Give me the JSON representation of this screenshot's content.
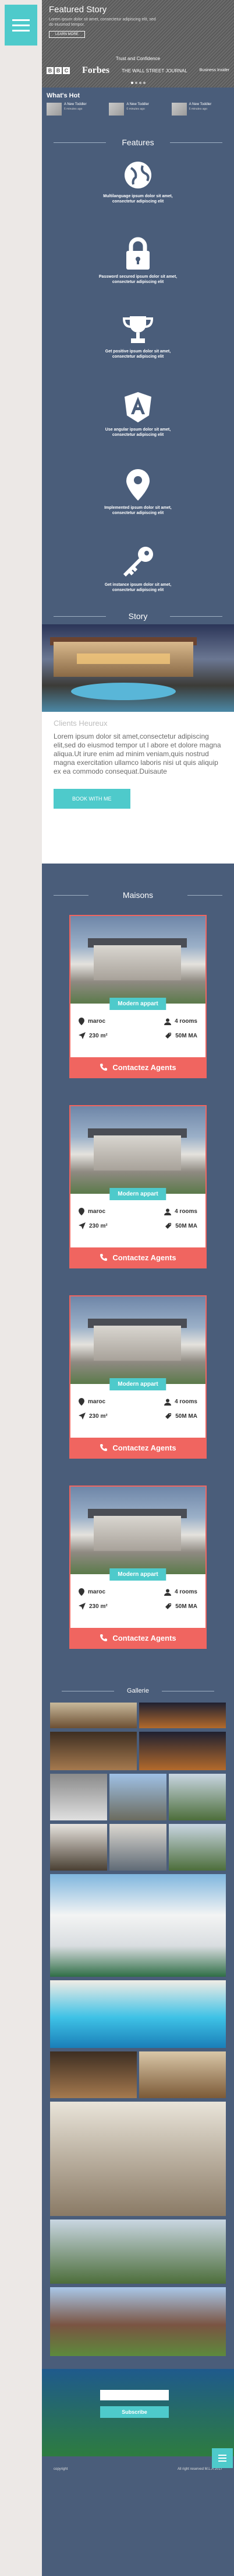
{
  "featured": {
    "title": "Featured Story",
    "text": "Lorem ipsum dolor sit amet, consectetur adipiscing elit, sed do eiusmod tempor.",
    "learn_label": "LEARN MORE",
    "trust_text": "Trust and Confidence"
  },
  "logos": {
    "bbc": [
      "B",
      "B",
      "C"
    ],
    "forbes": "Forbes",
    "wsj": "THE WALL STREET JOURNAL",
    "bi": "Business Insider"
  },
  "hot": {
    "title": "What's Hot",
    "items": [
      {
        "title": "A New Toddler",
        "date": "6 minutes ago"
      },
      {
        "title": "A New Toddler",
        "date": "6 minutes ago"
      },
      {
        "title": "A New Toddler",
        "date": "6 minutes ago"
      }
    ]
  },
  "features": {
    "title": "Features",
    "items": [
      {
        "icon": "globe-icon",
        "text": "Multilanguage ipsum dolor sit amet, consectetur adipiscing elit"
      },
      {
        "icon": "lock-icon",
        "text": "Password secured ipsum dolor sit amet, consectetur adipiscing elit"
      },
      {
        "icon": "trophy-icon",
        "text": "Get positive ipsum dolor sit amet, consectetur adipiscing elit"
      },
      {
        "icon": "angular-icon",
        "text": "Use angular ipsum dolor sit amet, consectetur adipiscing elit"
      },
      {
        "icon": "map-pin-icon",
        "text": "Implemented ipsum dolor sit amet, consectetur adipiscing elit"
      },
      {
        "icon": "key-icon",
        "text": "Get instance ipsum dolor sit amet, consectetur adipiscing elit"
      }
    ]
  },
  "story": {
    "title": "Story",
    "client_heading": "Clients Heureux",
    "body": "Lorem ipsum dolor sit amet,consectetur adipiscing elit,sed do eiusmod tempor ut l abore et dolore magna aliqua.Ut irure enim ad minim veniam,quis nostrud magna exercitation ullamco laboris nisi ut quis aliquip ex ea commodo consequat.Duisaute",
    "button_label": "BOOK WITH ME"
  },
  "maisons": {
    "title": "Maisons",
    "cards": [
      {
        "badge": "Modern appart",
        "location": "maroc",
        "rooms": "4 rooms",
        "area": "230 m²",
        "price": "50M MA",
        "cta": "Contactez Agents"
      },
      {
        "badge": "Modern appart",
        "location": "maroc",
        "rooms": "4 rooms",
        "area": "230 m²",
        "price": "50M MA",
        "cta": "Contactez Agents"
      },
      {
        "badge": "Modern appart",
        "location": "maroc",
        "rooms": "4 rooms",
        "area": "230 m²",
        "price": "50M MA",
        "cta": "Contactez Agents"
      },
      {
        "badge": "Modern appart",
        "location": "maroc",
        "rooms": "4 rooms",
        "area": "230 m²",
        "price": "50M MA",
        "cta": "Contactez Agents"
      }
    ]
  },
  "gallery": {
    "title": "Gallerie"
  },
  "subscribe": {
    "button_label": "Subscribe"
  },
  "footer": {
    "copyright": "copyright",
    "rights": "All right reserved M.L.A 2017"
  },
  "colors": {
    "accent": "#4ecacb",
    "cta": "#f06560",
    "bg": "#4a5d7a"
  }
}
